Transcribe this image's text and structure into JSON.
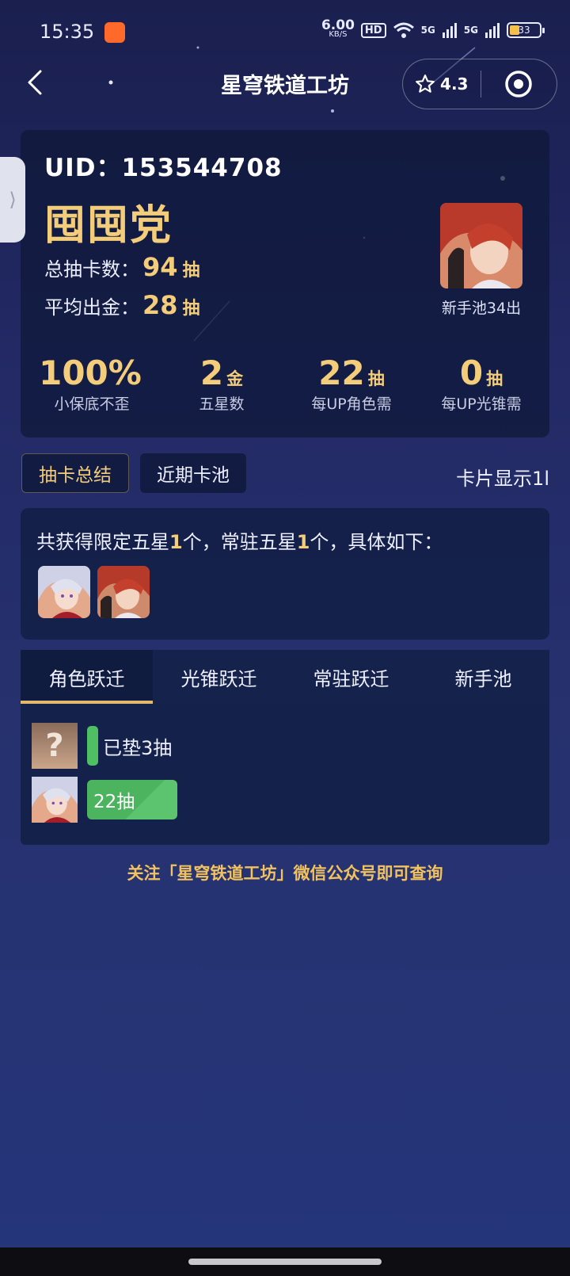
{
  "status_bar": {
    "time": "15:35",
    "net_speed_value": "6.00",
    "net_speed_unit": "KB/S",
    "hd_label": "HD",
    "signal_1": "5G",
    "signal_2": "5G",
    "battery_level": "33"
  },
  "nav": {
    "title": "星穹铁道工坊",
    "rating": "4.3"
  },
  "profile": {
    "uid_label": "UID：",
    "uid_value": "153544708",
    "nickname": "囤囤党",
    "total_pulls_label": "总抽卡数：",
    "total_pulls_value": "94",
    "total_pulls_unit": "抽",
    "avg_gold_label": "平均出金：",
    "avg_gold_value": "28",
    "avg_gold_unit": "抽",
    "portrait_caption": "新手池34出"
  },
  "metrics": [
    {
      "value": "100%",
      "unit": "",
      "label": "小保底不歪"
    },
    {
      "value": "2",
      "unit": "金",
      "label": "五星数"
    },
    {
      "value": "22",
      "unit": "抽",
      "label": "每UP角色需"
    },
    {
      "value": "0",
      "unit": "抽",
      "label": "每UP光锥需"
    }
  ],
  "tabs": {
    "summary": "抽卡总结",
    "recent": "近期卡池",
    "card_display": "卡片显示1l"
  },
  "summary": {
    "prefix": "共获得限定五星",
    "limited_count": "1",
    "middle": "个，常驻五星",
    "standard_count": "1",
    "suffix": "个，具体如下："
  },
  "banner_tabs": [
    "角色跃迁",
    "光锥跃迁",
    "常驻跃迁",
    "新手池"
  ],
  "pulls": {
    "pending_avatar_glyph": "?",
    "pending_label": "已垫3抽",
    "pending_pity": 3,
    "done_label": "22抽",
    "done_pity": 22
  },
  "footer": "关注「星穹铁道工坊」微信公众号即可查询",
  "colors": {
    "accent_gold": "#f4cd7b",
    "pity_green": "#4cb35e",
    "card_bg": "#121e44"
  }
}
